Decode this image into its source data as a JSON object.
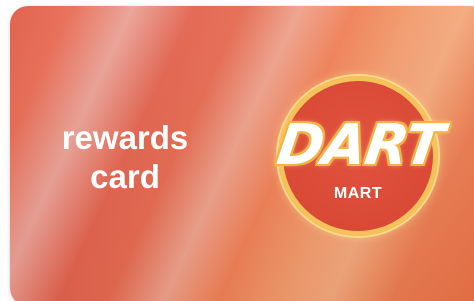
{
  "card": {
    "tagline_line1": "rewards",
    "tagline_line2": "card"
  },
  "logo": {
    "brand": "DART",
    "sub": "MART"
  },
  "colors": {
    "card_base": "#e2624d",
    "card_highlight": "#eea08a",
    "logo_red": "#d94a36",
    "logo_ring": "#f4c15a",
    "text": "#ffffff"
  }
}
